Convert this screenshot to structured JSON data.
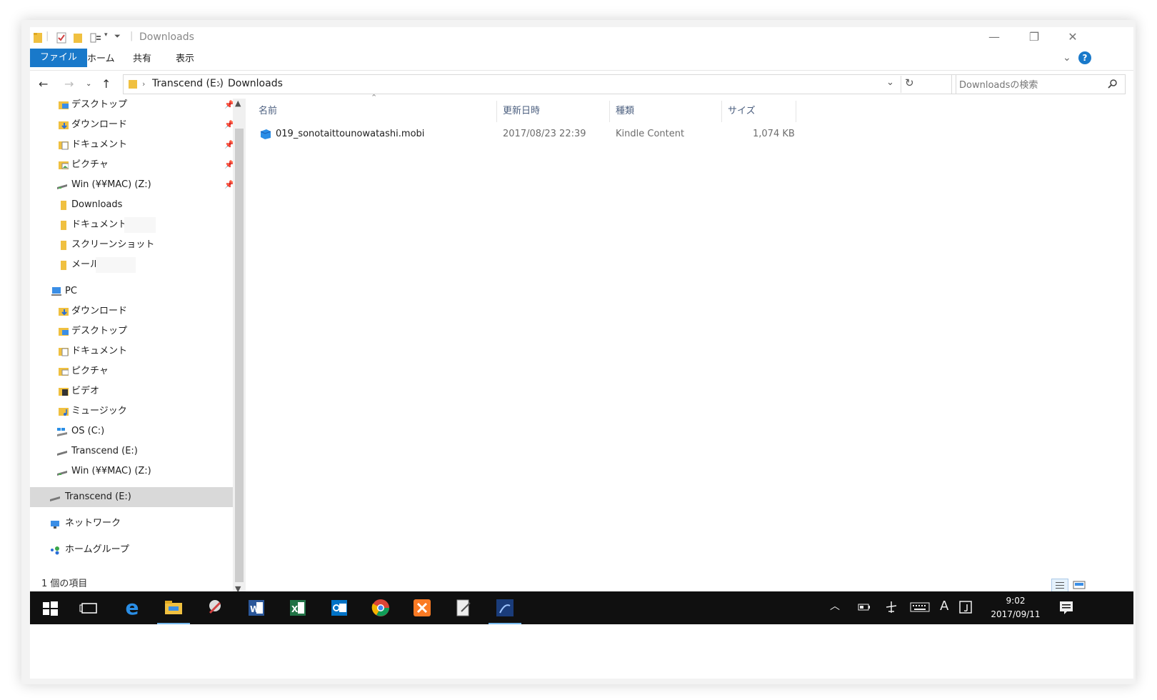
{
  "window": {
    "title": "Downloads",
    "ribbon_tabs": [
      "ファイル",
      "ホーム",
      "共有",
      "表示"
    ]
  },
  "address": {
    "crumbs": [
      "Transcend (E:)",
      "Downloads"
    ]
  },
  "search": {
    "placeholder": "Downloadsの検索"
  },
  "nav": {
    "quick_access": [
      {
        "label": "デスクトップ",
        "pinned": true
      },
      {
        "label": "ダウンロード",
        "pinned": true
      },
      {
        "label": "ドキュメント",
        "pinned": true
      },
      {
        "label": "ピクチャ",
        "pinned": true
      },
      {
        "label": "Win (¥¥MAC) (Z:)",
        "pinned": true
      },
      {
        "label": "Downloads",
        "pinned": false
      },
      {
        "label": "ドキュメント",
        "pinned": false
      },
      {
        "label": "スクリーンショット",
        "pinned": false
      },
      {
        "label": "メール",
        "pinned": false
      }
    ],
    "pc_label": "PC",
    "pc_items": [
      "ダウンロード",
      "デスクトップ",
      "ドキュメント",
      "ピクチャ",
      "ビデオ",
      "ミュージック",
      "OS (C:)",
      "Transcend (E:)",
      "Win (¥¥MAC) (Z:)"
    ],
    "selected": "Transcend (E:)",
    "network": "ネットワーク",
    "homegroup": "ホームグループ"
  },
  "columns": {
    "name": "名前",
    "modified": "更新日時",
    "type": "種類",
    "size": "サイズ"
  },
  "files": [
    {
      "name": "019_sonotaittounowatashi.mobi",
      "modified": "2017/08/23 22:39",
      "type": "Kindle Content",
      "size": "1,074 KB"
    }
  ],
  "status": {
    "count": "1 個の項目"
  },
  "taskbar": {
    "time": "9:02",
    "date": "2017/09/11",
    "ime": "A"
  },
  "colors": {
    "accent": "#1979ca",
    "taskbar": "#101010",
    "selection": "#d9d9d9",
    "folder": "#f0c040"
  }
}
